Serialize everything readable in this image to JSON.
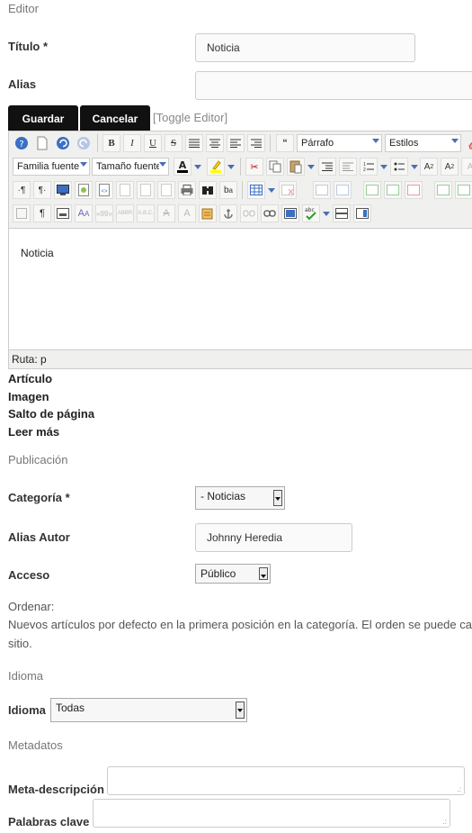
{
  "sections": {
    "editor": "Editor",
    "publicacion": "Publicación",
    "idioma": "Idioma",
    "metadatos": "Metadatos"
  },
  "fields": {
    "titulo_label": "Título *",
    "titulo_value": "Noticia",
    "alias_label": "Alias",
    "alias_value": "",
    "categoria_label": "Categoría *",
    "categoria_value": "- Noticias",
    "alias_autor_label": "Alias Autor",
    "alias_autor_value": "Johnny Heredia",
    "acceso_label": "Acceso",
    "acceso_value": "Público",
    "ordenar_label": "Ordenar:",
    "ordenar_note_line1": "Nuevos artículos por defecto en la primera posición en la categoría. El orden se puede ca",
    "ordenar_note_line2": "sitio.",
    "idioma_label": "Idioma",
    "idioma_value": "Todas",
    "meta_desc_label": "Meta-descripción",
    "palabras_clave_label": "Palabras clave"
  },
  "actions": {
    "save": "Guardar",
    "cancel": "Cancelar",
    "toggle_editor": "[Toggle Editor]"
  },
  "editor": {
    "format_select": "Párrafo",
    "styles_select": "Estilos",
    "font_family_select": "Familia fuente",
    "font_size_select": "Tamaño fuente",
    "content_text": "Noticia",
    "path_label": "Ruta: p"
  },
  "editor_buttons": {
    "articulo": "Artículo",
    "imagen": "Imagen",
    "salto_pagina": "Salto de página",
    "leer_mas": "Leer más"
  },
  "colors": {
    "button_dark": "#111111",
    "toolbar_bg": "#f0f0ee",
    "dropdown_arrow": "#4a6fb5"
  }
}
